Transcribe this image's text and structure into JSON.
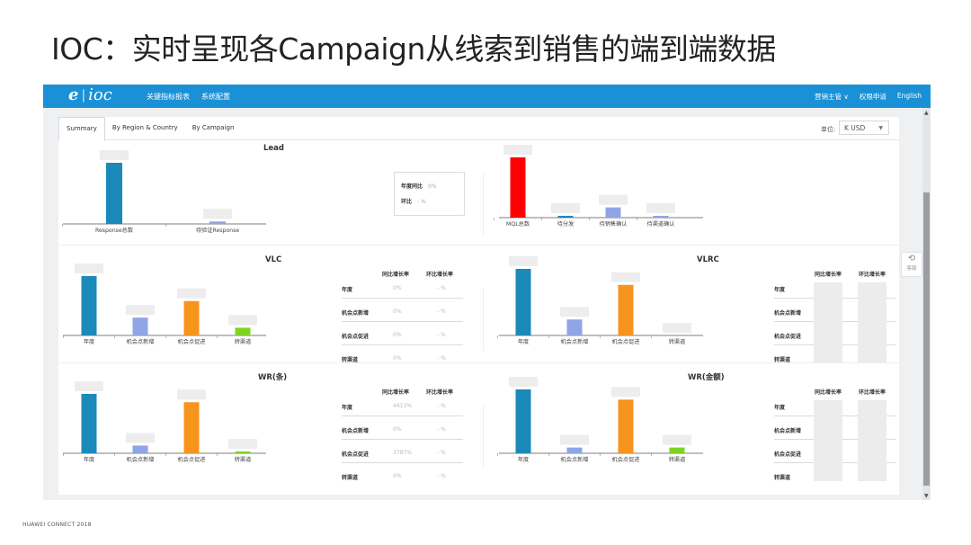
{
  "slide": {
    "title": "IOC：实时呈现各Campaign从线索到销售的端到端数据",
    "footer": "HUAWEI CONNECT 2018"
  },
  "app": {
    "logo": {
      "mark": "e",
      "text": "ioc"
    },
    "nav": [
      "关键指标报表",
      "系统配置"
    ],
    "right_menu": [
      "营销主管 ∨",
      "权限申请",
      "English"
    ],
    "tabs": [
      "Summary",
      "By Region & Country",
      "By Campaign"
    ],
    "active_tab": "Summary",
    "unit_label": "单位:",
    "unit_value": "K USD",
    "float_button": {
      "icon": "refresh-icon",
      "label": "客服"
    }
  },
  "colors": {
    "header_blue": "#1a91d6",
    "bar_blue": "#1b8ab8",
    "bar_lightblue": "#8fa5e6",
    "bar_orange": "#f7941e",
    "bar_green": "#7ed321",
    "bar_red": "#ff0000"
  },
  "sections": {
    "lead": {
      "title": "Lead",
      "kpi": [
        {
          "label": "年度同比",
          "value": "0%"
        },
        {
          "label": "环比",
          "value": "- %"
        }
      ]
    },
    "vlc": {
      "title": "VLC"
    },
    "vlrc": {
      "title": "VLRC"
    },
    "wr_count": {
      "title": "WR(条)"
    },
    "wr_amount": {
      "title": "WR(金额)"
    }
  },
  "growth_headers": [
    "同比增长率",
    "环比增长率"
  ],
  "growth_rows": [
    "年度",
    "机会点新增",
    "机会点促进",
    "转渠道"
  ],
  "vlc_table": [
    {
      "yoy": "0%",
      "mom": "- %"
    },
    {
      "yoy": "0%",
      "mom": "- %"
    },
    {
      "yoy": "0%",
      "mom": "- %"
    },
    {
      "yoy": "0%",
      "mom": "- %"
    }
  ],
  "wr_table": [
    {
      "yoy": "4413%",
      "mom": "- %"
    },
    {
      "yoy": "0%",
      "mom": "- %"
    },
    {
      "yoy": "3787%",
      "mom": "- %"
    },
    {
      "yoy": "0%",
      "mom": "- %"
    }
  ],
  "chart_data": [
    {
      "type": "bar",
      "title": "Lead",
      "categories": [
        "Response总数",
        "待验证Response"
      ],
      "values": [
        1.0,
        0.04
      ],
      "colors": [
        "#1b8ab8",
        "#8fa5e6"
      ]
    },
    {
      "type": "bar",
      "title": "",
      "categories": [
        "MQL总数",
        "待分发",
        "待销售确认",
        "待渠道确认"
      ],
      "values": [
        1.0,
        0.03,
        0.17,
        0.02
      ],
      "colors": [
        "#ff0000",
        "#1b8ab8",
        "#8fa5e6",
        "#8fa5e6"
      ]
    },
    {
      "type": "bar",
      "title": "VLC",
      "categories": [
        "年度",
        "机会点新增",
        "机会点促进",
        "转渠道"
      ],
      "values": [
        1.0,
        0.3,
        0.58,
        0.13
      ],
      "colors": [
        "#1b8ab8",
        "#8fa5e6",
        "#f7941e",
        "#7ed321"
      ]
    },
    {
      "type": "bar",
      "title": "VLRC",
      "categories": [
        "年度",
        "机会点新增",
        "机会点促进",
        "转渠道"
      ],
      "values": [
        1.0,
        0.24,
        0.76,
        0.0
      ],
      "colors": [
        "#1b8ab8",
        "#8fa5e6",
        "#f7941e",
        "#7ed321"
      ]
    },
    {
      "type": "bar",
      "title": "WR(条)",
      "categories": [
        "年度",
        "机会点新增",
        "机会点促进",
        "转渠道"
      ],
      "values": [
        1.0,
        0.13,
        0.86,
        0.02
      ],
      "colors": [
        "#1b8ab8",
        "#8fa5e6",
        "#f7941e",
        "#7ed321"
      ]
    },
    {
      "type": "bar",
      "title": "WR(金额)",
      "categories": [
        "年度",
        "机会点新增",
        "机会点促进",
        "转渠道"
      ],
      "values": [
        1.0,
        0.09,
        0.84,
        0.09
      ],
      "colors": [
        "#1b8ab8",
        "#8fa5e6",
        "#f7941e",
        "#7ed321"
      ]
    }
  ]
}
